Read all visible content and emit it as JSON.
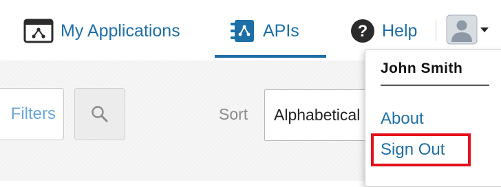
{
  "header": {
    "nav": {
      "my_applications": "My Applications",
      "apis": "APIs",
      "help": "Help"
    },
    "active_tab": "APIs"
  },
  "toolbar": {
    "filters_label": "Filters",
    "sort_label": "Sort",
    "sort_value": "Alphabetical"
  },
  "user_menu": {
    "user_name": "John Smith",
    "items": [
      "About",
      "Sign Out"
    ],
    "highlighted_item": "Sign Out"
  },
  "colors": {
    "link_blue": "#1d6fa8",
    "highlight_red": "#e3101b",
    "background": "#f5f5f5"
  },
  "icons": {
    "my_applications": "applications-window-icon",
    "apis": "api-book-icon",
    "help": "help-question-icon",
    "search": "search-icon",
    "avatar": "user-avatar-icon"
  }
}
